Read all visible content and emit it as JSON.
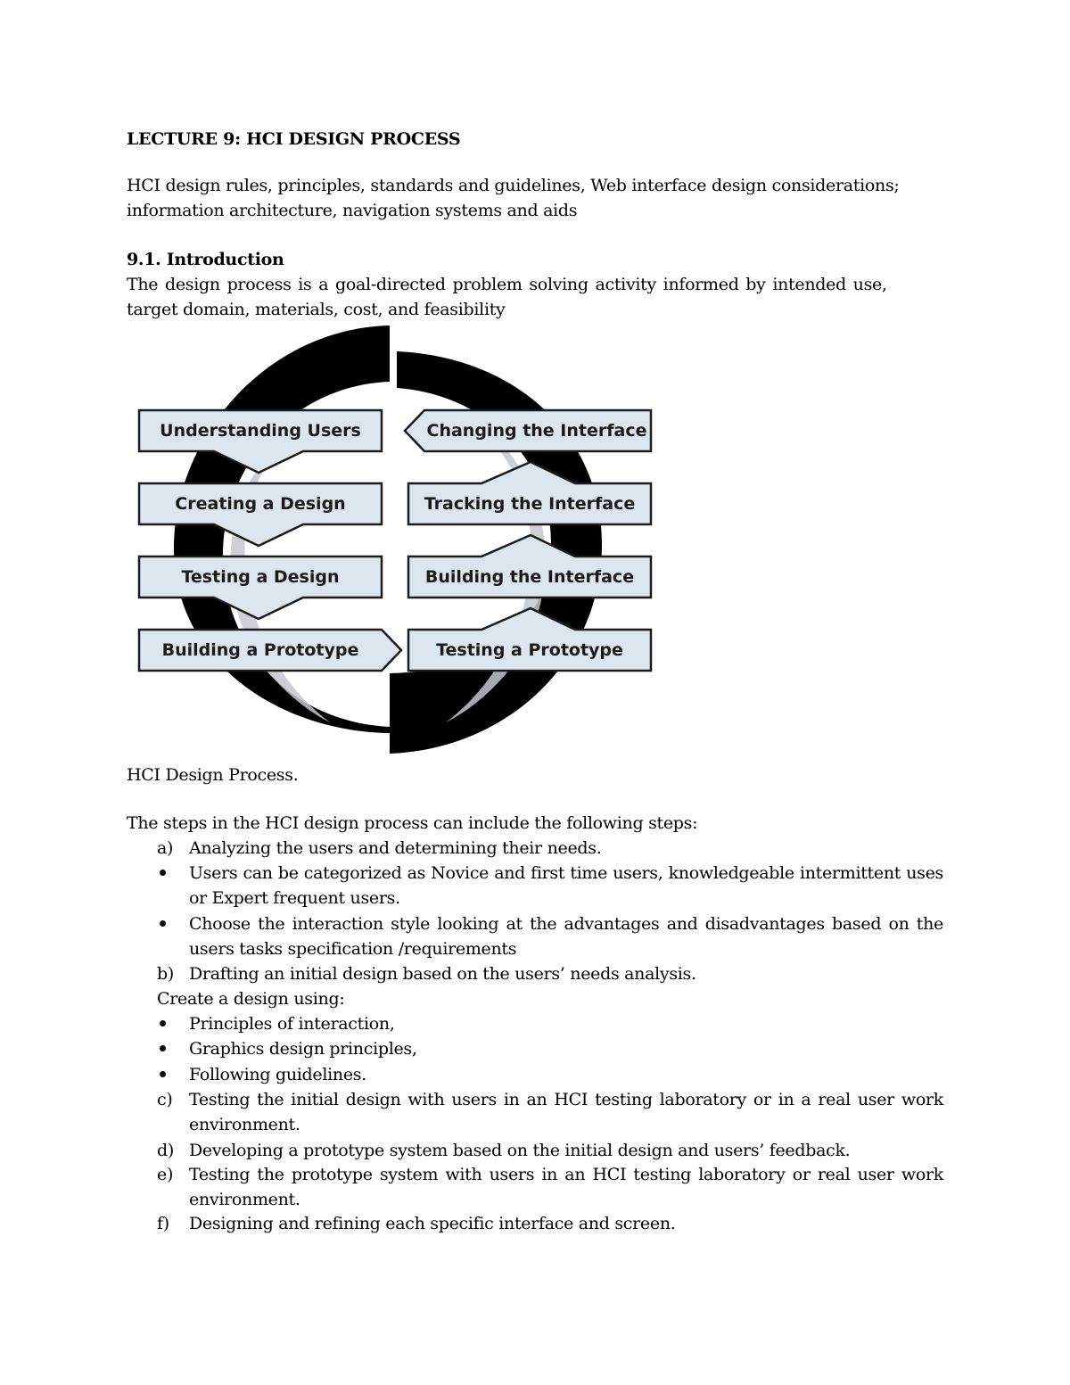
{
  "document": {
    "title": "LECTURE 9: HCI DESIGN PROCESS",
    "subtitle_line1": "HCI design rules, principles, standards and guidelines, Web interface design considerations;",
    "subtitle_line2": "information architecture, navigation systems and aids",
    "section_heading": "9.1. Introduction",
    "intro_line1": "The design process is a goal-directed problem solving activity informed by intended use,",
    "intro_line2": "target domain, materials, cost, and feasibility"
  },
  "figure": {
    "caption": "HCI Design Process.",
    "colors": {
      "box_fill": "#dde5ef",
      "box_stroke": "#1a1a1a",
      "ring": "#000000",
      "ring_overlay": "#c3c8cf"
    },
    "left_column": [
      {
        "label": "Understanding Users"
      },
      {
        "label": "Creating a Design"
      },
      {
        "label": "Testing a Design"
      },
      {
        "label": "Building a Prototype"
      }
    ],
    "right_column": [
      {
        "label": "Changing the Interface"
      },
      {
        "label": "Tracking the Interface"
      },
      {
        "label": "Building the Interface"
      },
      {
        "label": "Testing a Prototype"
      }
    ]
  },
  "steps": {
    "intro": "The steps in the HCI design process can include the following steps:",
    "items": [
      {
        "marker": "a)",
        "type": "letter",
        "text": "Analyzing the users and determining their needs."
      },
      {
        "marker": "•",
        "type": "bullet",
        "text": "Users can be categorized as Novice and first time users, knowledgeable intermittent uses or Expert frequent users."
      },
      {
        "marker": "•",
        "type": "bullet",
        "text": "Choose the interaction style looking at the advantages and disadvantages based on the users tasks specification /requirements"
      },
      {
        "marker": "b)",
        "type": "letter",
        "text": "Drafting an initial design based on the users’ needs analysis."
      },
      {
        "marker": "",
        "type": "plain",
        "text": "Create a design using:"
      },
      {
        "marker": "•",
        "type": "bullet",
        "text": "Principles of interaction,"
      },
      {
        "marker": "•",
        "type": "bullet",
        "text": "Graphics design principles,"
      },
      {
        "marker": "•",
        "type": "bullet",
        "text": "Following guidelines."
      },
      {
        "marker": "c)",
        "type": "letter",
        "text": "Testing the initial design with users in an HCI testing laboratory or in a real user work environment."
      },
      {
        "marker": "d)",
        "type": "letter",
        "text": "Developing a prototype system based on the initial design and users’ feedback."
      },
      {
        "marker": "e)",
        "type": "letter",
        "text": "Testing the prototype system with users in an HCI testing laboratory or real user work environment."
      },
      {
        "marker": "f)",
        "type": "letter",
        "text": "Designing and refining each specific interface and screen."
      }
    ]
  }
}
